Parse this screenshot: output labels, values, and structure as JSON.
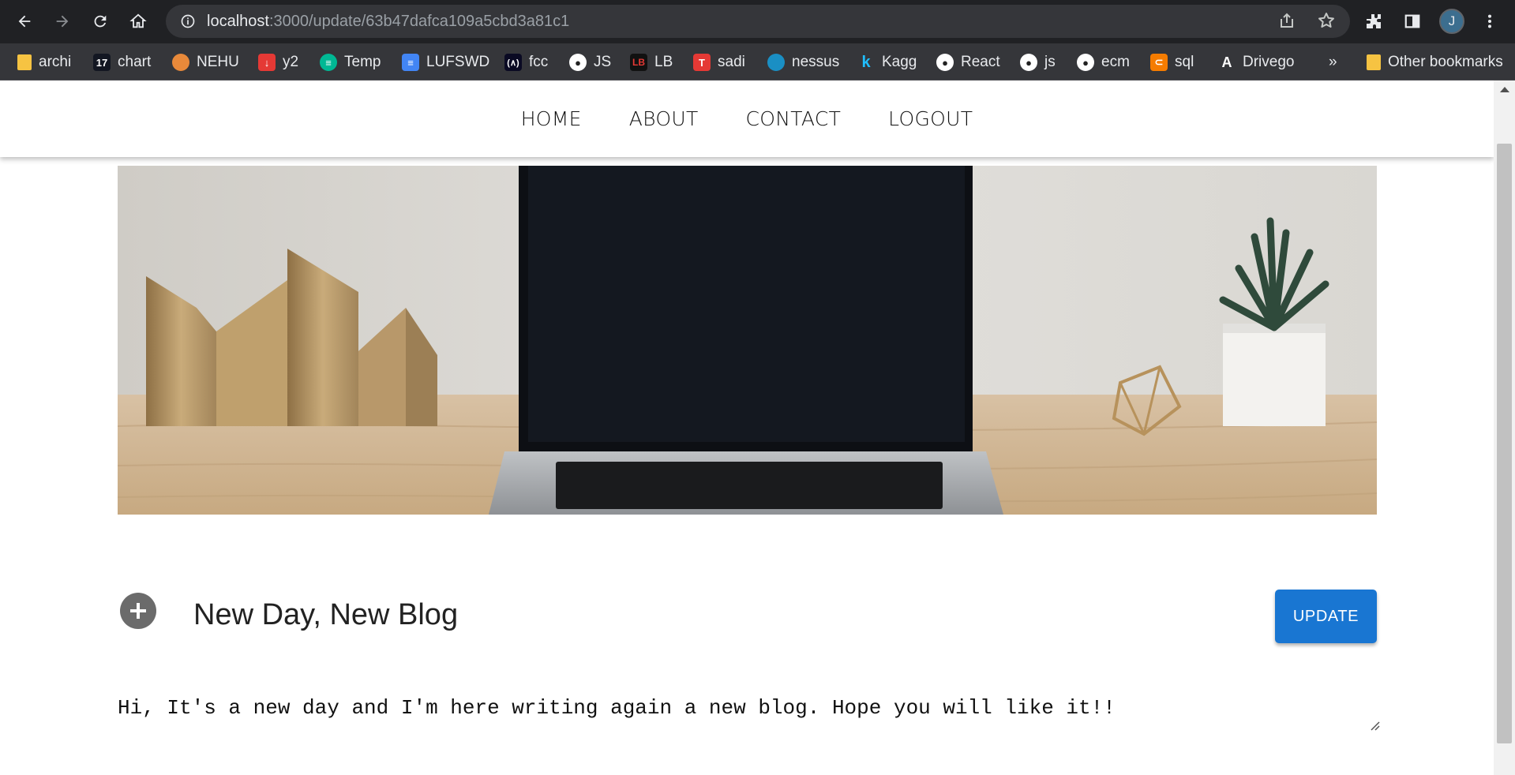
{
  "browser": {
    "url_host": "localhost",
    "url_path": ":3000/update/63b47dafca109a5cbd3a81c1",
    "profile_initial": "J",
    "bookmarks": [
      {
        "label": "archi",
        "icon": "folder-icon",
        "color": "#f6c342"
      },
      {
        "label": "chart",
        "icon": "tradingview-icon",
        "color": "#131722"
      },
      {
        "label": "NEHU",
        "icon": "nehu-logo-icon",
        "color": "#e8893a"
      },
      {
        "label": "y2",
        "icon": "download-icon",
        "color": "#e53935"
      },
      {
        "label": "Temp",
        "icon": "temp-icon",
        "color": "#00b894"
      },
      {
        "label": "LUFSWD",
        "icon": "docs-icon",
        "color": "#4285f4"
      },
      {
        "label": "fcc",
        "icon": "freecodecamp-icon",
        "color": "#0a0a23"
      },
      {
        "label": "JS",
        "icon": "github-icon",
        "color": "#ffffff"
      },
      {
        "label": "LB",
        "icon": "lb-icon",
        "color": "#111111"
      },
      {
        "label": "sadi",
        "icon": "sadi-icon",
        "color": "#e53935"
      },
      {
        "label": "nessus",
        "icon": "nessus-icon",
        "color": "#1a8fc4"
      },
      {
        "label": "Kagg",
        "icon": "kaggle-icon",
        "color": "#20beff"
      },
      {
        "label": "React",
        "icon": "github-icon",
        "color": "#ffffff"
      },
      {
        "label": "js",
        "icon": "github-icon",
        "color": "#ffffff"
      },
      {
        "label": "ecm",
        "icon": "github-icon",
        "color": "#ffffff"
      },
      {
        "label": "sql",
        "icon": "sql-icon",
        "color": "#f57c00"
      },
      {
        "label": "Drivego",
        "icon": "drivego-icon",
        "color": "#ffffff"
      }
    ],
    "overflow": "»",
    "other_bookmarks": "Other bookmarks"
  },
  "site": {
    "nav": [
      "HOME",
      "ABOUT",
      "CONTACT",
      "LOGOUT"
    ],
    "post": {
      "title": "New Day, New Blog",
      "content": "Hi, It's a new day and I'm here writing again a new blog. Hope you will like it!!",
      "update_label": "UPDATE"
    }
  },
  "colors": {
    "chrome_dark": "#202124",
    "toolbar": "#35363a",
    "accent": "#1976d2"
  }
}
